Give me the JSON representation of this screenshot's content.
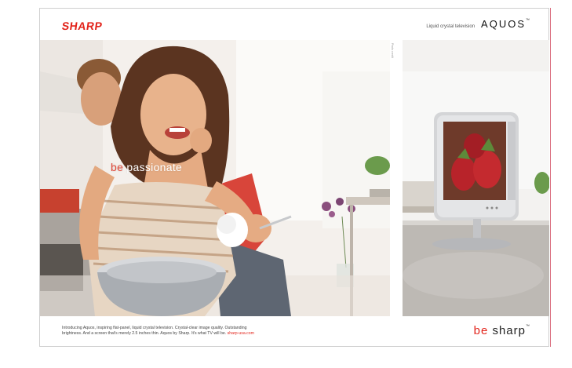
{
  "header": {
    "brand": "SHARP",
    "tagline": "Liquid crystal television",
    "product": "AQUOS",
    "product_tm": "™"
  },
  "main": {
    "headline_accent": "be",
    "headline_word": "passionate",
    "photo_credit": "Photo credit"
  },
  "footer": {
    "copy_line1": "Introducing Aquos, inspiring flat-panel, liquid crystal television. Crystal-clear image quality. Outstanding",
    "copy_line2": "brightness. And a screen that's merely 2.5 inches thin. Aquos by Sharp. It's what TV will be.",
    "copy_link": "sharp-usa.com",
    "slogan_accent": "be",
    "slogan_word": "sharp",
    "slogan_tm": "™"
  },
  "colors": {
    "brand_red": "#e2231a",
    "accent_coral": "#e24b3c",
    "page_edge": "#d9687a"
  }
}
